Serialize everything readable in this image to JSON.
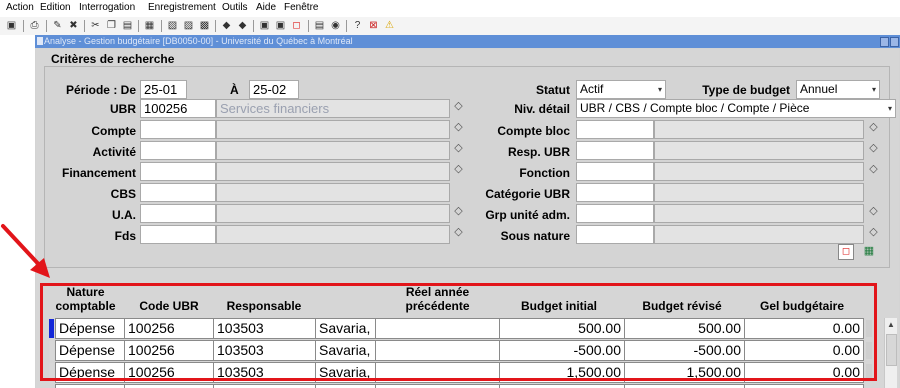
{
  "menu": [
    "Action",
    "Edition",
    "Interrogation",
    "Enregistrement",
    "Outils",
    "Aide",
    "Fenêtre"
  ],
  "window": {
    "title": "Analyse - Gestion budgétaire [DB0050-00] - Université du Québec à Montréal"
  },
  "criteria": {
    "title": "Critères de recherche",
    "periode_label": "Période : De",
    "periode_from": "25-01",
    "a_label": "À",
    "periode_to": "25-02",
    "ubr_label": "UBR",
    "ubr_code": "100256",
    "ubr_desc": "Services financiers",
    "compte_label": "Compte",
    "activite_label": "Activité",
    "financement_label": "Financement",
    "cbs_label": "CBS",
    "ua_label": "U.A.",
    "fds_label": "Fds",
    "statut_label": "Statut",
    "statut_value": "Actif",
    "type_budget_label": "Type de budget",
    "type_budget_value": "Annuel",
    "niv_detail_label": "Niv. détail",
    "niv_detail_value": "UBR / CBS / Compte bloc / Compte / Pièce",
    "compte_bloc_label": "Compte bloc",
    "resp_ubr_label": "Resp. UBR",
    "fonction_label": "Fonction",
    "categorie_ubr_label": "Catégorie UBR",
    "grp_unite_label": "Grp unité adm.",
    "sous_nature_label": "Sous nature"
  },
  "grid": {
    "headers": {
      "nature": "Nature comptable",
      "code_ubr": "Code UBR",
      "responsable": "Responsable",
      "reel": "Réel année précédente",
      "budget_initial": "Budget initial",
      "budget_revise": "Budget révisé",
      "gel": "Gel budgétaire"
    },
    "rows": [
      {
        "nature": "Dépense",
        "code_ubr": "100256",
        "resp_code": "103503",
        "resp_name": "Savaria, I",
        "reel": "",
        "budget_initial": "500.00",
        "budget_revise": "500.00",
        "gel": "0.00"
      },
      {
        "nature": "Dépense",
        "code_ubr": "100256",
        "resp_code": "103503",
        "resp_name": "Savaria, I",
        "reel": "",
        "budget_initial": "-500.00",
        "budget_revise": "-500.00",
        "gel": "0.00"
      },
      {
        "nature": "Dépense",
        "code_ubr": "100256",
        "resp_code": "103503",
        "resp_name": "Savaria, I",
        "reel": "",
        "budget_initial": "1,500.00",
        "budget_revise": "1,500.00",
        "gel": "0.00"
      }
    ]
  },
  "colors": {
    "highlight_border": "#e2151a",
    "title_bar": "#5f8fd7",
    "current_row_indicator": "#1428d8"
  }
}
